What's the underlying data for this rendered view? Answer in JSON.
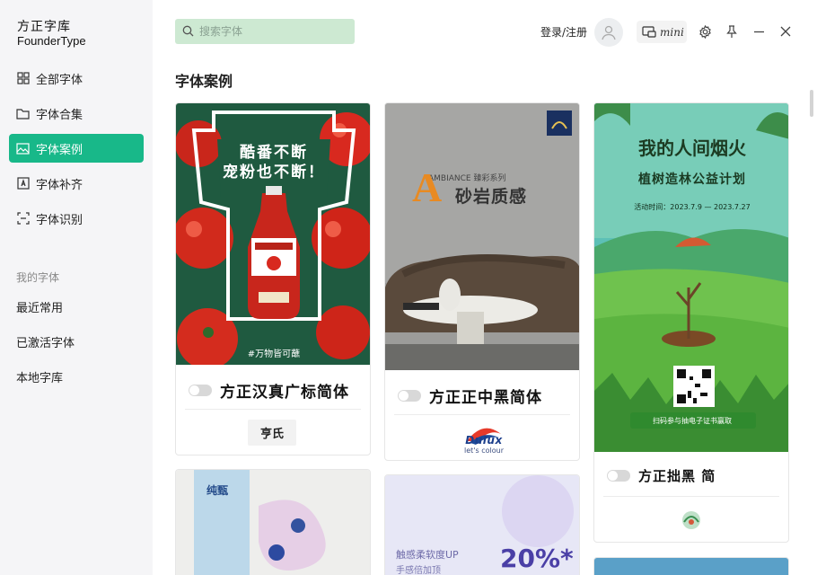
{
  "app": {
    "logo_cn": "方正字库",
    "logo_en": "FounderType"
  },
  "sidebar": {
    "nav": [
      {
        "label": "全部字体",
        "icon": "grid-icon"
      },
      {
        "label": "字体合集",
        "icon": "folder-icon"
      },
      {
        "label": "字体案例",
        "icon": "image-icon"
      },
      {
        "label": "字体补齐",
        "icon": "font-fill-icon"
      },
      {
        "label": "字体识别",
        "icon": "scan-icon"
      }
    ],
    "active_index": 2,
    "section_label": "我的字体",
    "my_fonts": [
      "最近常用",
      "已激活字体",
      "本地字库"
    ]
  },
  "topbar": {
    "search_placeholder": "搜索字体",
    "login_label": "登录/注册",
    "mini_label": "mini"
  },
  "main": {
    "title": "字体案例",
    "cards": [
      {
        "poster_title_1": "酷番不断",
        "poster_title_2": "宠粉也不断！",
        "poster_hashtag": "#万物皆可蘸",
        "font_name": "方正汉真广标简体",
        "brand": "亨氏"
      },
      {
        "poster_brand_line": "AMBIANCE 臻彩系列",
        "poster_title": "砂岩质感",
        "font_name": "方正正中黑简体",
        "brand": "Dulux",
        "brand_sub": "let's colour"
      },
      {
        "poster_title_1": "我的人间烟火",
        "poster_title_2": "植树造林公益计划",
        "poster_dates": "活动时间：2023.7.9 — 2023.7.27",
        "poster_qr_caption": "扫码参与抽电子证书赢取",
        "font_name": "方正拙黑 简"
      },
      {
        "poster_text": "纯甄",
        "font_name": ""
      },
      {
        "poster_line": "触感柔软度UP",
        "poster_line2": "手感倍加顶",
        "poster_percent": "20%*"
      }
    ]
  },
  "colors": {
    "accent": "#18b889",
    "search_bg": "#cde9d2"
  }
}
